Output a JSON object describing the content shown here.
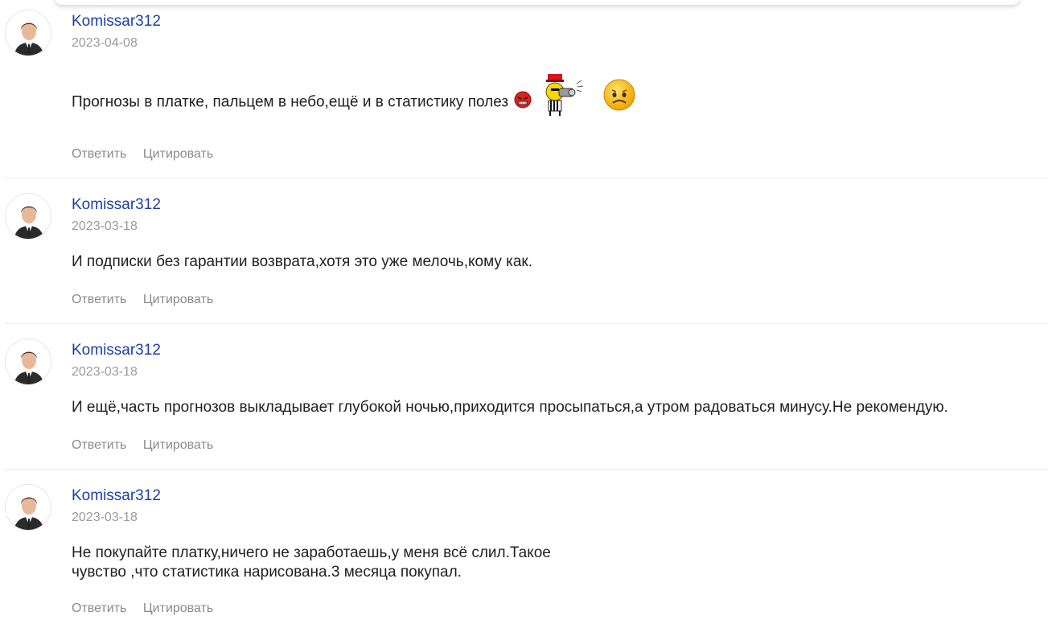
{
  "comments": [
    {
      "author": "Komissar312",
      "date": "2023-04-08",
      "text": "Прогнозы в платке, пальцем в небо,ещё и в статистику полез",
      "reply_label": "Ответить",
      "quote_label": "Цитировать",
      "emojis": [
        "angry-red-smiley-icon",
        "policeman-whistle-smiley-icon",
        "sad-smiley-icon"
      ]
    },
    {
      "author": "Komissar312",
      "date": "2023-03-18",
      "text": "И подписки без гарантии возврата,хотя это уже мелочь,кому как.",
      "reply_label": "Ответить",
      "quote_label": "Цитировать"
    },
    {
      "author": "Komissar312",
      "date": "2023-03-18",
      "text": "И ещё,часть прогнозов выкладывает глубокой ночью,приходится просыпаться,а утром радоваться минусу.Не рекомендую.",
      "reply_label": "Ответить",
      "quote_label": "Цитировать"
    },
    {
      "author": "Komissar312",
      "date": "2023-03-18",
      "text_line1": "Не покупайте платку,ничего не заработаешь,у меня всё слил.Такое",
      "text_line2": "чувство ,что статистика нарисована.3 месяца покупал.",
      "reply_label": "Ответить",
      "quote_label": "Цитировать"
    }
  ]
}
